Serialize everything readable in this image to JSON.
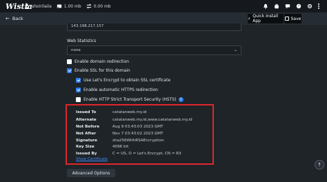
{
  "topbar": {
    "logo": "Wistia",
    "user": "shoirilaila",
    "storage": "1.00 mb",
    "traffic": "0.00 mb"
  },
  "actionbar": {
    "back_label": "Back",
    "quick_install_label": "Quick Install App",
    "save_label": "Save"
  },
  "form": {
    "ip_value": "143.198.217.157",
    "web_statistics_label": "Web Statistics",
    "web_statistics_value": "none",
    "options": [
      {
        "label": "Enable domain redirection",
        "checked": false
      },
      {
        "label": "Enable SSL for this domain",
        "checked": true
      },
      {
        "label": "Use Let's Encrypt to obtain SSL certificate",
        "checked": true
      },
      {
        "label": "Enable automatic HTTPS redirection",
        "checked": true
      },
      {
        "label": "Enable HTTP Strict Transport Security (HSTS)",
        "checked": false
      }
    ]
  },
  "certificate": {
    "rows": [
      {
        "key": "Issued To",
        "value": "catatanweb.my.id"
      },
      {
        "key": "Alternate",
        "value": "catatanweb.my.id,www.catatanweb.my.id"
      },
      {
        "key": "Not Before",
        "value": "Aug 9 03:43:03 2023 GMT"
      },
      {
        "key": "Not After",
        "value": "Nov 7 03:43:02 2023 GMT"
      },
      {
        "key": "Signature",
        "value": "sha256WithRSAEncryption"
      },
      {
        "key": "Key Size",
        "value": "4096 bit"
      },
      {
        "key": "Issued By",
        "value": "C = US, O = Let's Encrypt, CN = R3"
      }
    ],
    "show_label": "Show Certificate"
  },
  "advanced_label": "Advanced Options",
  "colors": {
    "accent": "#2d7df6",
    "highlight_border": "#e1262b",
    "link": "#3e8bff"
  }
}
